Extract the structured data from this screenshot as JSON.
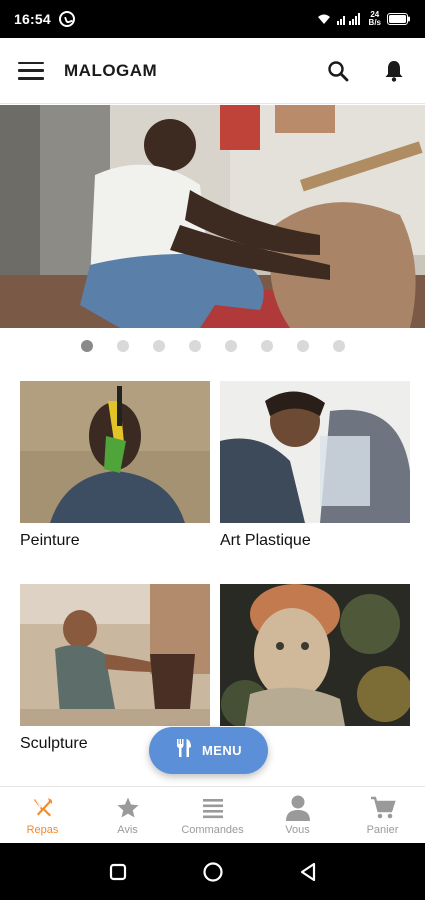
{
  "status_bar": {
    "time": "16:54",
    "net_speed_top": "24",
    "net_speed_bottom": "B/s"
  },
  "app_bar": {
    "title": "MALOGAM",
    "icons": [
      "menu-icon",
      "search-icon",
      "bell-icon"
    ]
  },
  "carousel": {
    "slide_count": 8,
    "active_index": 0
  },
  "categories": [
    {
      "label": "Peinture"
    },
    {
      "label": "Art Plastique"
    },
    {
      "label": "Sculpture"
    },
    {
      "label": ""
    }
  ],
  "fab": {
    "label": "MENU",
    "icon": "fork-knife-icon",
    "color": "#5b8fd8"
  },
  "bottom_nav": {
    "active_color": "#f08a2d",
    "inactive_color": "#9a9a9a",
    "items": [
      {
        "label": "Repas",
        "icon": "fork-knife-icon",
        "active": true
      },
      {
        "label": "Avis",
        "icon": "star-icon",
        "active": false
      },
      {
        "label": "Commandes",
        "icon": "list-icon",
        "active": false
      },
      {
        "label": "Vous",
        "icon": "person-icon",
        "active": false
      },
      {
        "label": "Panier",
        "icon": "cart-icon",
        "active": false
      }
    ]
  }
}
